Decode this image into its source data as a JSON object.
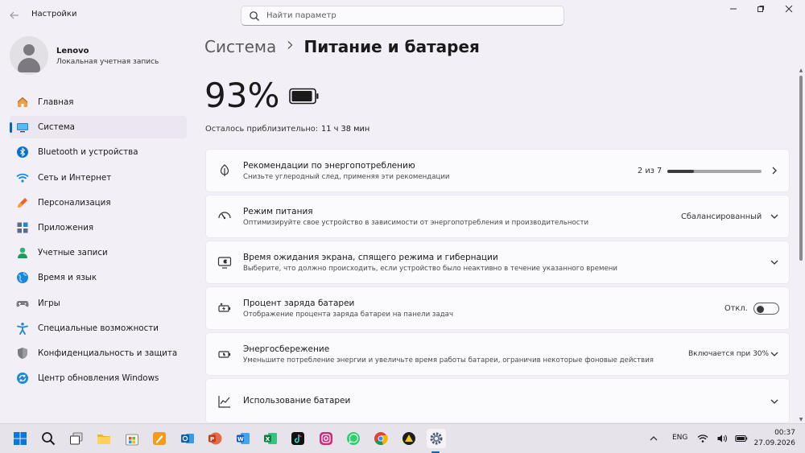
{
  "window": {
    "title": "Настройки",
    "search_placeholder": "Найти параметр"
  },
  "profile": {
    "name": "Lenovo",
    "account_type": "Локальная учетная запись"
  },
  "sidebar": {
    "items": [
      {
        "label": "Главная",
        "icon": "home-icon"
      },
      {
        "label": "Система",
        "icon": "system-icon",
        "active": true
      },
      {
        "label": "Bluetooth и устройства",
        "icon": "bluetooth-icon"
      },
      {
        "label": "Сеть и Интернет",
        "icon": "wifi-icon"
      },
      {
        "label": "Персонализация",
        "icon": "brush-icon"
      },
      {
        "label": "Приложения",
        "icon": "apps-icon"
      },
      {
        "label": "Учетные записи",
        "icon": "accounts-icon"
      },
      {
        "label": "Время и язык",
        "icon": "globe-icon"
      },
      {
        "label": "Игры",
        "icon": "gamepad-icon"
      },
      {
        "label": "Специальные возможности",
        "icon": "accessibility-icon"
      },
      {
        "label": "Конфиденциальность и защита",
        "icon": "shield-icon"
      },
      {
        "label": "Центр обновления Windows",
        "icon": "update-icon"
      }
    ]
  },
  "breadcrumb": {
    "parent": "Система",
    "current": "Питание и батарея"
  },
  "battery": {
    "percent_label": "93%",
    "level": 0.93,
    "remaining_label": "Осталось приблизительно:",
    "remaining_value": "11 ч 38 мин"
  },
  "cards": {
    "recommendations": {
      "title": "Рекомендации по энергопотреблению",
      "subtitle": "Снизьте углеродный след, применяя эти рекомендации",
      "count": "2 из 7",
      "progress": 0.286
    },
    "power_mode": {
      "title": "Режим питания",
      "subtitle": "Оптимизируйте свое устройство в зависимости от энергопотребления и производительности",
      "value": "Сбалансированный"
    },
    "sleep": {
      "title": "Время ожидания экрана, спящего режима и гибернации",
      "subtitle": "Выберите, что должно происходить, если устройство было неактивно в течение указанного времени"
    },
    "battery_percent": {
      "title": "Процент заряда батареи",
      "subtitle": "Отображение процента заряда батареи на панели задач",
      "toggle_label": "Откл.",
      "toggle_on": false
    },
    "energy_saver": {
      "title": "Энергосбережение",
      "subtitle": "Уменьшите потребление энергии и увеличьте время работы батареи, ограничив некоторые фоновые действия",
      "value": "Включается при 30%"
    },
    "battery_usage": {
      "title": "Использование батареи"
    }
  },
  "taskbar": {
    "apps": [
      "start-icon",
      "search-icon",
      "task-view-icon",
      "file-explorer-icon",
      "store-icon",
      "pages-icon",
      "outlook-icon",
      "powerpoint-icon",
      "word-icon",
      "excel-icon",
      "tiktok-icon",
      "instagram-icon",
      "whatsapp-icon",
      "chrome-icon",
      "vpn-icon",
      "settings-icon"
    ],
    "language": "ENG",
    "time": "00:37",
    "date": "27.09.2026"
  },
  "colors": {
    "accent": "#0067c0",
    "background": "#f3eff6",
    "card": "#fbfafc"
  }
}
